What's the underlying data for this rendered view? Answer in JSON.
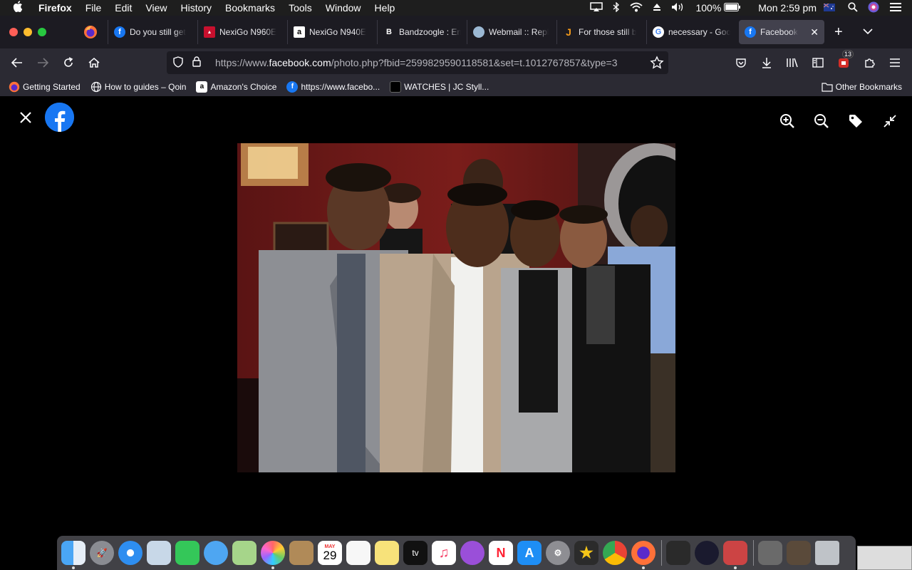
{
  "menubar": {
    "app_name": "Firefox",
    "items": [
      "File",
      "Edit",
      "View",
      "History",
      "Bookmarks",
      "Tools",
      "Window",
      "Help"
    ],
    "battery": "100%",
    "clock": "Mon 2:59 pm"
  },
  "tabs": [
    {
      "label": "Do you still get",
      "icon": "facebook-icon"
    },
    {
      "label": "NexiGo N960E",
      "icon": "nexigo-icon"
    },
    {
      "label": "NexiGo N940E",
      "icon": "amazon-icon"
    },
    {
      "label": "Bandzoogle : En",
      "icon": "bandzoogle-icon"
    },
    {
      "label": "Webmail :: Repl",
      "icon": "webmail-icon"
    },
    {
      "label": "For those still b",
      "icon": "j-icon"
    },
    {
      "label": "necessary - Goo",
      "icon": "google-icon"
    },
    {
      "label": "Facebook",
      "icon": "facebook-icon",
      "active": true
    }
  ],
  "navbar": {
    "url_prefix": "https://www.",
    "url_domain": "facebook.com",
    "url_rest": "/photo.php?fbid=2599829590118581&set=t.1012767857&type=3",
    "extension_badge": "13"
  },
  "bookmarks": [
    {
      "label": "Getting Started",
      "icon": "firefox-icon"
    },
    {
      "label": "How to guides – Qoin",
      "icon": "globe-icon"
    },
    {
      "label": "Amazon's Choice",
      "icon": "amazon-icon"
    },
    {
      "label": "https://www.facebo...",
      "icon": "facebook-icon"
    },
    {
      "label": "WATCHES | JC Styll...",
      "icon": "square-icon"
    }
  ],
  "other_bookmarks": "Other Bookmarks",
  "dock": {
    "calendar_month": "MAY",
    "calendar_day": "29",
    "tv_label": "tv"
  },
  "colors": {
    "facebook_blue": "#1877f2",
    "tab_bar": "#1c1b22",
    "toolbar": "#2b2a33"
  }
}
